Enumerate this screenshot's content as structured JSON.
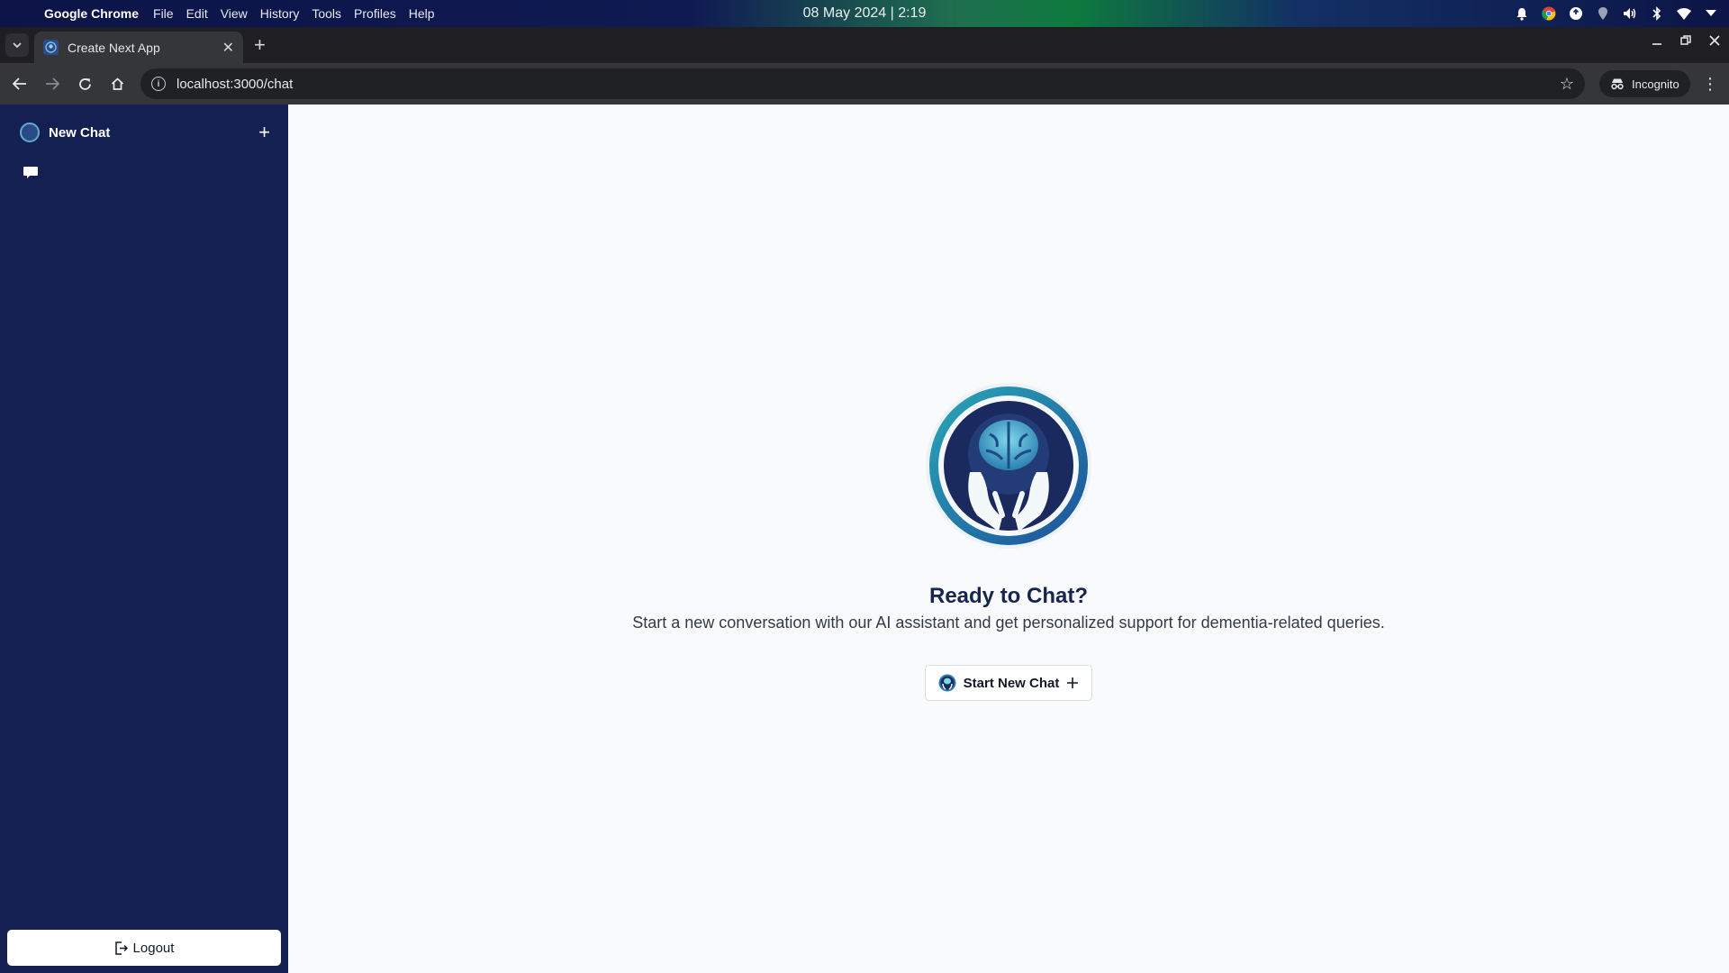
{
  "os": {
    "app_name": "Google Chrome",
    "menu": [
      "File",
      "Edit",
      "View",
      "History",
      "Tools",
      "Profiles",
      "Help"
    ],
    "clock": "08 May 2024 | 2:19"
  },
  "browser": {
    "tab_title": "Create Next App",
    "url": "localhost:3000/chat",
    "incognito_label": "Incognito"
  },
  "sidebar": {
    "title": "New Chat",
    "logout_label": "Logout"
  },
  "main": {
    "title": "Ready to Chat?",
    "subtitle": "Start a new conversation with our AI assistant and get personalized support for dementia-related queries.",
    "start_button_label": "Start New Chat"
  },
  "colors": {
    "sidebar_bg": "#141f52",
    "brand_navy": "#1b2a5e",
    "brand_teal": "#2d9bb3",
    "main_bg": "#f8fafc"
  }
}
